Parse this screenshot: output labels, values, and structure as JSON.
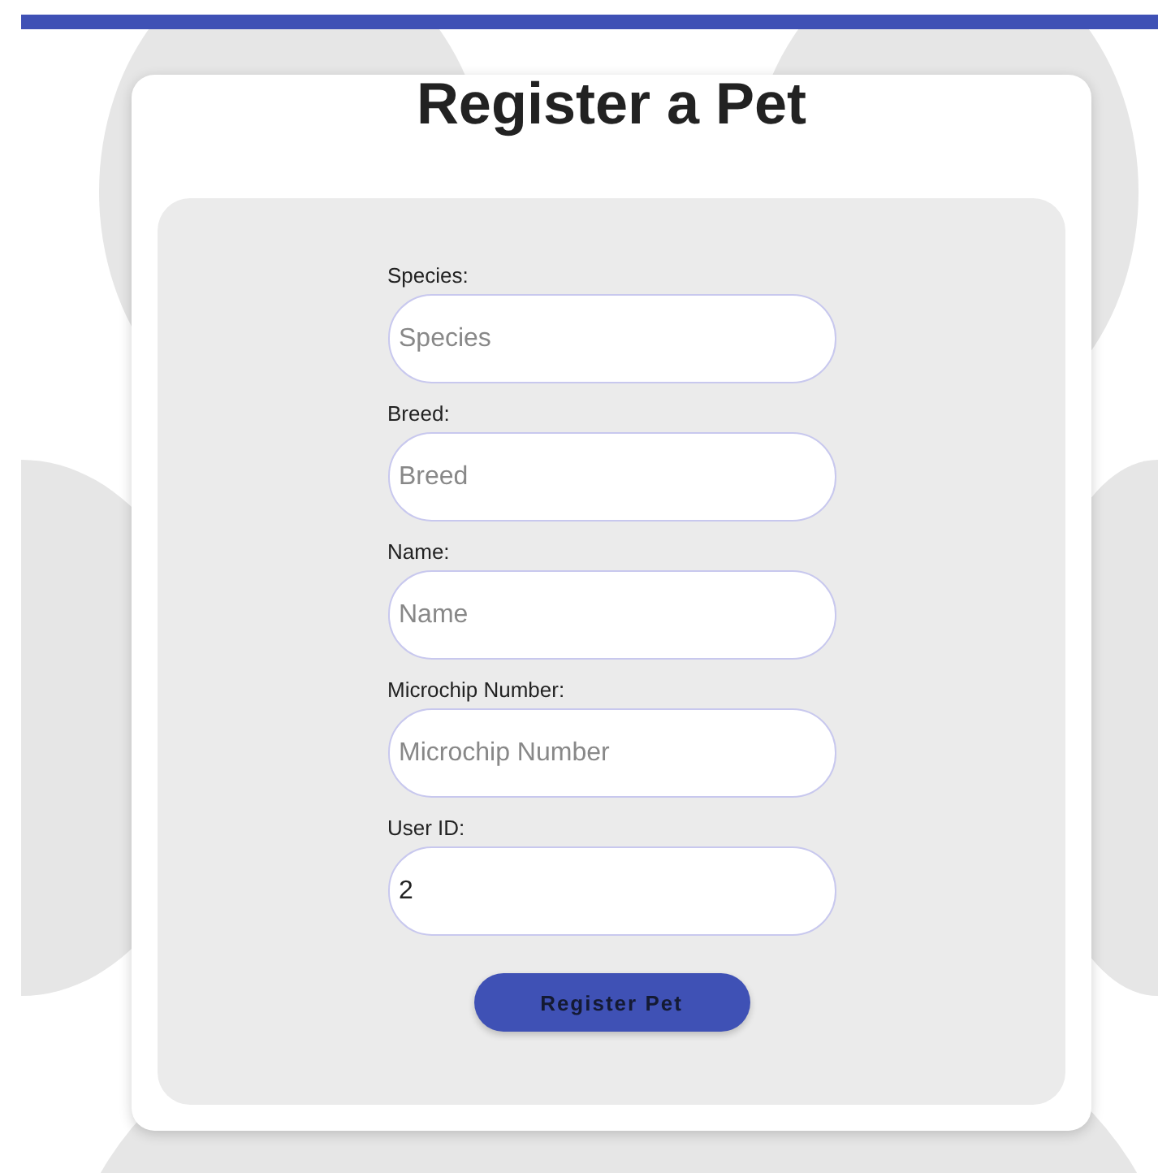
{
  "title": "Register a Pet",
  "fields": [
    {
      "label": "Species:",
      "placeholder": "Species"
    },
    {
      "label": "Breed:",
      "placeholder": "Breed"
    },
    {
      "label": "Name:",
      "placeholder": "Name"
    },
    {
      "label": "Microchip Number:",
      "placeholder": "Microchip Number"
    },
    {
      "label": "User ID:",
      "value": "2"
    }
  ],
  "submit_button": "Register Pet"
}
